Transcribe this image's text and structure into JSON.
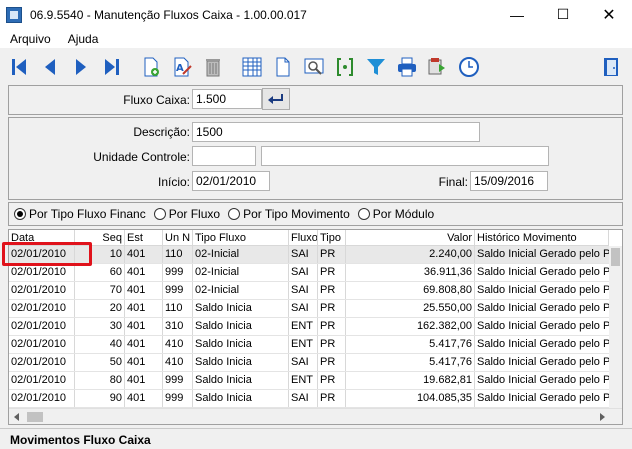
{
  "window": {
    "title": "06.9.5540 - Manutenção Fluxos Caixa - 1.00.00.017",
    "minimize": "—",
    "maximize": "☐",
    "close": "✕"
  },
  "menu": [
    "Arquivo",
    "Ajuda"
  ],
  "form": {
    "fluxo_caixa_label": "Fluxo Caixa:",
    "fluxo_caixa_value": "1.500",
    "descricao_label": "Descrição:",
    "descricao_value": "1500",
    "unidade_label": "Unidade Controle:",
    "unidade_code": "",
    "unidade_name": "",
    "inicio_label": "Início:",
    "inicio_value": "02/01/2010",
    "final_label": "Final:",
    "final_value": "15/09/2016"
  },
  "radios": [
    {
      "label": "Por Tipo Fluxo Financ",
      "checked": true
    },
    {
      "label": "Por Fluxo",
      "checked": false
    },
    {
      "label": "Por Tipo Movimento",
      "checked": false
    },
    {
      "label": "Por Módulo",
      "checked": false
    }
  ],
  "grid": {
    "columns": [
      "Data",
      "Seq",
      "Est",
      "Un N",
      "Tipo Fluxo",
      "Fluxo",
      "Tipo",
      "Valor",
      "Histórico Movimento"
    ],
    "rows": [
      [
        "02/01/2010",
        "10",
        "401",
        "110",
        "02-Inicial",
        "SAI",
        "PR",
        "2.240,00",
        "Saldo Inicial Gerado pelo Program"
      ],
      [
        "02/01/2010",
        "60",
        "401",
        "999",
        "02-Inicial",
        "SAI",
        "PR",
        "36.911,36",
        "Saldo Inicial Gerado pelo Program"
      ],
      [
        "02/01/2010",
        "70",
        "401",
        "999",
        "02-Inicial",
        "SAI",
        "PR",
        "69.808,80",
        "Saldo Inicial Gerado pelo Program"
      ],
      [
        "02/01/2010",
        "20",
        "401",
        "110",
        "Saldo Inicia",
        "SAI",
        "PR",
        "25.550,00",
        "Saldo Inicial Gerado pelo Program"
      ],
      [
        "02/01/2010",
        "30",
        "401",
        "310",
        "Saldo Inicia",
        "ENT",
        "PR",
        "162.382,00",
        "Saldo Inicial Gerado pelo Program"
      ],
      [
        "02/01/2010",
        "40",
        "401",
        "410",
        "Saldo Inicia",
        "ENT",
        "PR",
        "5.417,76",
        "Saldo Inicial Gerado pelo Program"
      ],
      [
        "02/01/2010",
        "50",
        "401",
        "410",
        "Saldo Inicia",
        "SAI",
        "PR",
        "5.417,76",
        "Saldo Inicial Gerado pelo Program"
      ],
      [
        "02/01/2010",
        "80",
        "401",
        "999",
        "Saldo Inicia",
        "ENT",
        "PR",
        "19.682,81",
        "Saldo Inicial Gerado pelo Program"
      ],
      [
        "02/01/2010",
        "90",
        "401",
        "999",
        "Saldo Inicia",
        "SAI",
        "PR",
        "104.085,35",
        "Saldo Inicial Gerado pelo Program"
      ]
    ]
  },
  "status": "Movimentos Fluxo Caixa",
  "colors": {
    "highlight": "#e0121b",
    "nav_blue": "#1f5fbf"
  }
}
